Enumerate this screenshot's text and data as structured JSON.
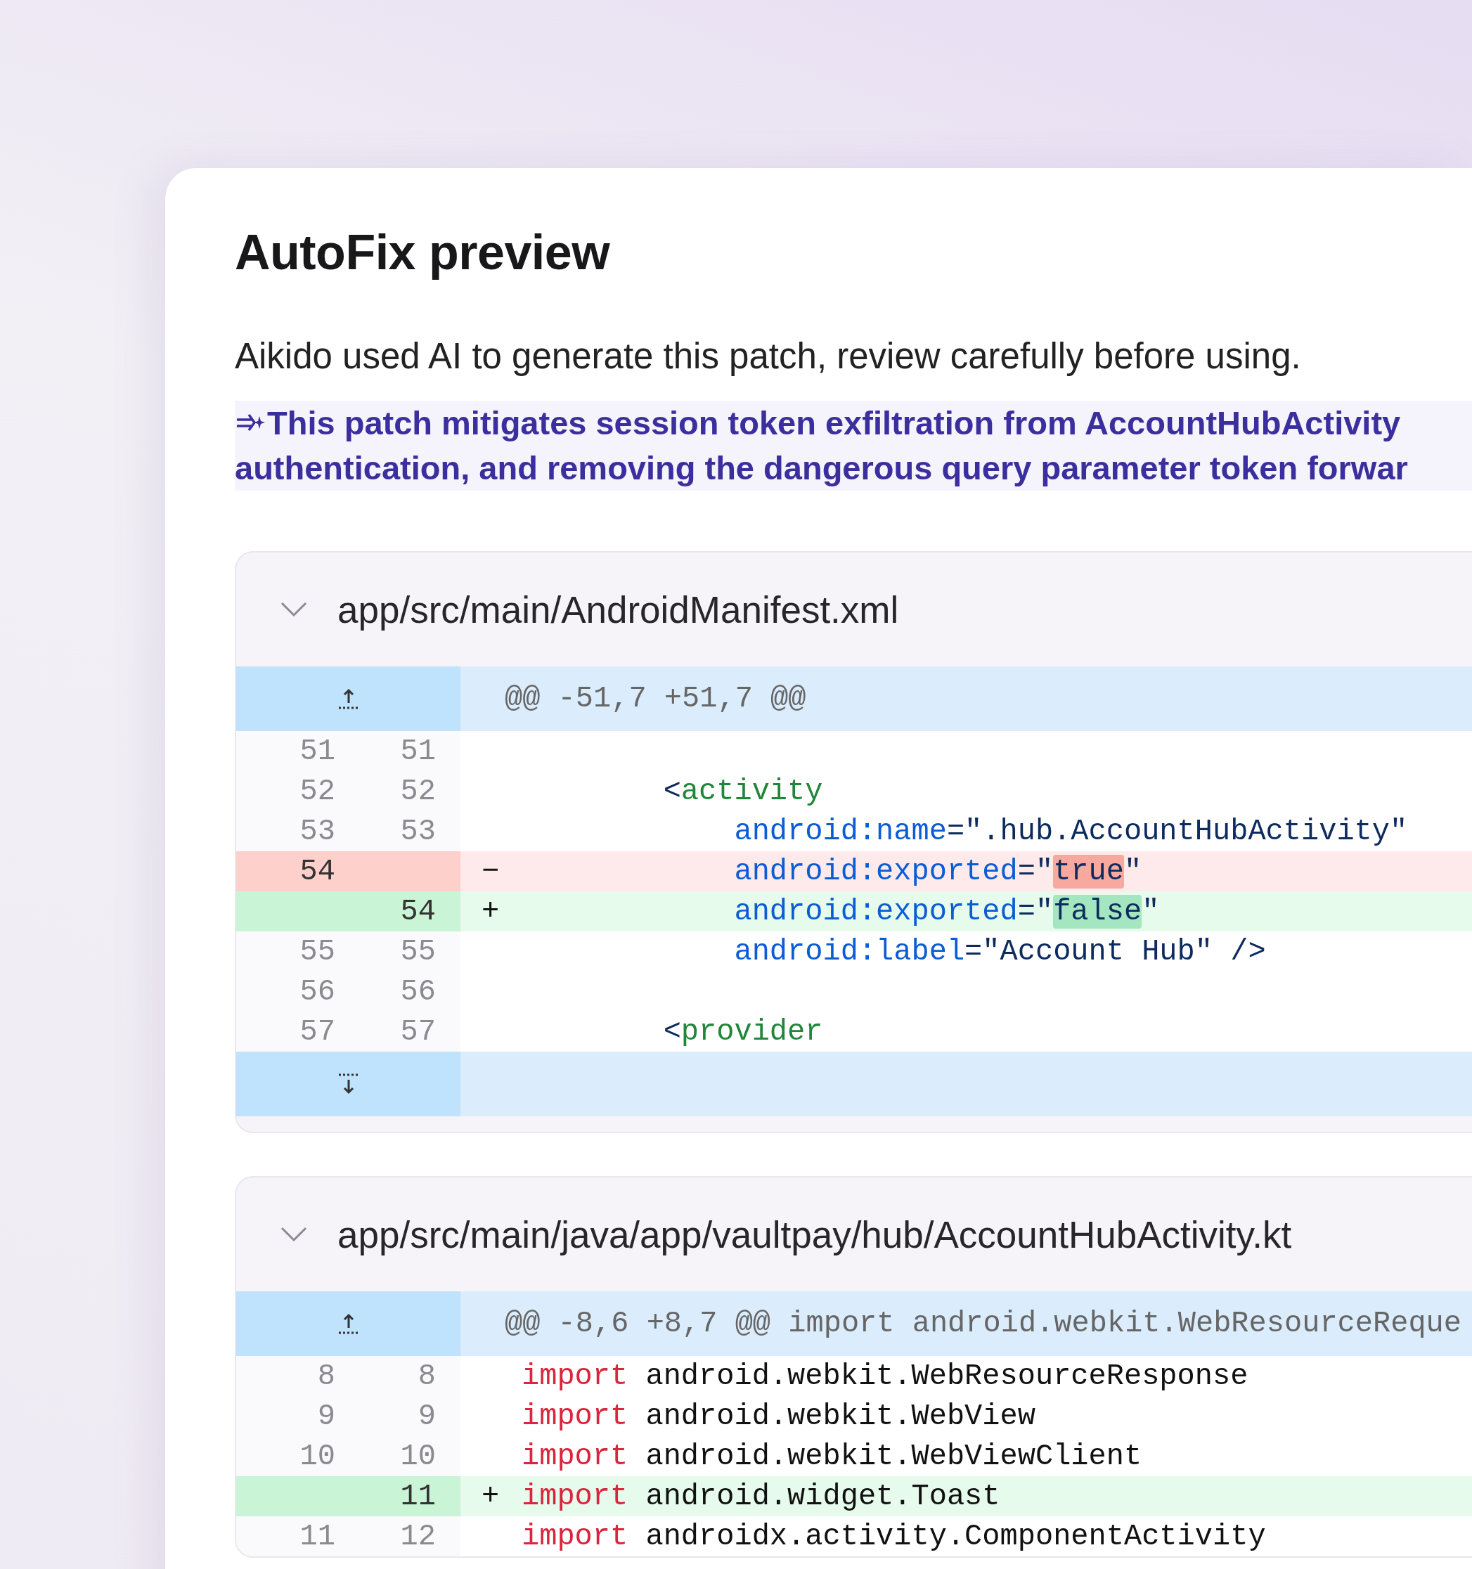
{
  "title": "AutoFix preview",
  "description": "Aikido used AI to generate this patch, review carefully before using.",
  "summary": [
    "This patch mitigates session token exfiltration from AccountHubActivity",
    "authentication, and removing the dangerous query parameter token forwar"
  ],
  "files": [
    {
      "path": "app/src/main/AndroidManifest.xml",
      "expanded": true,
      "hunk_header": "@@ -51,7 +51,7 @@",
      "lines": [
        {
          "kind": "context",
          "old": "51",
          "new": "51"
        },
        {
          "kind": "context",
          "old": "52",
          "new": "52",
          "segments": [
            {
              "text": "        <",
              "kind": "plain"
            },
            {
              "text": "activity",
              "kind": "tag"
            }
          ]
        },
        {
          "kind": "context",
          "old": "53",
          "new": "53",
          "segments": [
            {
              "text": "            android:name",
              "kind": "attr"
            },
            {
              "text": "=\".hub.AccountHubActivity\"",
              "kind": "plain"
            }
          ]
        },
        {
          "kind": "removed",
          "old": "54",
          "sign": "−",
          "segments": [
            {
              "text": "            android:exported",
              "kind": "attr",
              "highlighted": false
            },
            {
              "text": "=\"",
              "kind": "plain",
              "highlighted": false
            },
            {
              "text": "true",
              "kind": "plain",
              "highlighted": true
            },
            {
              "text": "\"",
              "kind": "plain",
              "highlighted": false
            }
          ]
        },
        {
          "kind": "added",
          "new": "54",
          "sign": "+",
          "segments": [
            {
              "text": "            android:exported",
              "kind": "attr",
              "highlighted": false
            },
            {
              "text": "=\"",
              "kind": "plain",
              "highlighted": false
            },
            {
              "text": "false",
              "kind": "plain",
              "highlighted": true
            },
            {
              "text": "\"",
              "kind": "plain",
              "highlighted": false
            }
          ]
        },
        {
          "kind": "context",
          "old": "55",
          "new": "55",
          "segments": [
            {
              "text": "            android:label",
              "kind": "attr"
            },
            {
              "text": "=\"Account Hub\" />",
              "kind": "plain"
            }
          ]
        },
        {
          "kind": "context",
          "old": "56",
          "new": "56"
        },
        {
          "kind": "context",
          "old": "57",
          "new": "57",
          "segments": [
            {
              "text": "        <",
              "kind": "plain"
            },
            {
              "text": "provider",
              "kind": "tag"
            }
          ]
        },
        {
          "kind": "expander"
        }
      ]
    },
    {
      "path": "app/src/main/java/app/vaultpay/hub/AccountHubActivity.kt",
      "expanded": true,
      "hunk_header": "@@ -8,6 +8,7 @@ import android.webkit.WebResourceReque",
      "lines": [
        {
          "kind": "context",
          "old": "8",
          "new": "8",
          "segments": [
            {
              "text": "import",
              "kind": "keyword"
            },
            {
              "text": " android.webkit.WebResourceResponse",
              "kind": "code"
            }
          ]
        },
        {
          "kind": "context",
          "old": "9",
          "new": "9",
          "segments": [
            {
              "text": "import",
              "kind": "keyword"
            },
            {
              "text": " android.webkit.WebView",
              "kind": "code"
            }
          ]
        },
        {
          "kind": "context",
          "old": "10",
          "new": "10",
          "segments": [
            {
              "text": "import",
              "kind": "keyword"
            },
            {
              "text": " android.webkit.WebViewClient",
              "kind": "code"
            }
          ]
        },
        {
          "kind": "added",
          "new": "11",
          "sign": "+",
          "segments": [
            {
              "text": "import",
              "kind": "keyword"
            },
            {
              "text": " android.widget.Toast",
              "kind": "code"
            }
          ]
        },
        {
          "kind": "context",
          "old": "11",
          "new": "12",
          "segments": [
            {
              "text": "import",
              "kind": "keyword"
            },
            {
              "text": " androidx.activity.ComponentActivity",
              "kind": "code"
            }
          ]
        }
      ]
    }
  ]
}
